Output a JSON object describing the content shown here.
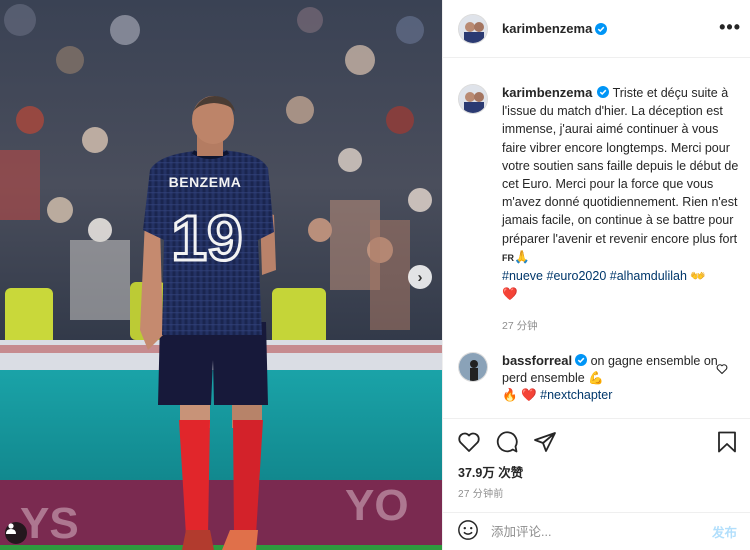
{
  "post": {
    "image_alt": "Karim Benzema in France jersey number 19 walking away on the pitch",
    "jersey_name": "BENZEMA",
    "jersey_number": "19"
  },
  "header": {
    "username": "karimbenzema",
    "verified": true,
    "more_icon": "more-options-icon"
  },
  "caption": {
    "username": "karimbenzema",
    "text": "Triste et déçu suite à l'issue du match d'hier. La déception est immense, j'aurai aimé continuer à vous faire vibrer encore longtemps. Merci pour votre soutien sans faille depuis le début de cet Euro. Merci pour la force que vous m'avez donné quotidiennement. Rien n'est jamais facile, on continue à se battre pour préparer l'avenir et revenir encore plus fort ",
    "flag": "FR",
    "pray_emoji": "🙏",
    "hashtags": [
      "#nueve",
      "#euro2020",
      "#alhamdulilah"
    ],
    "hands_emoji": "👐",
    "heart_emoji": "❤️",
    "time": "27 分钟"
  },
  "comment": {
    "username": "bassforreal",
    "verified": true,
    "text": "on gagne ensemble on perd ensemble",
    "muscle_emoji": "💪",
    "fire_emoji": "🔥",
    "heart_emoji": "❤️",
    "hashtag": "#nextchapter"
  },
  "actions": {
    "like_icon": "heart-icon",
    "comment_icon": "comment-bubble-icon",
    "share_icon": "paper-plane-icon",
    "save_icon": "bookmark-icon"
  },
  "stats": {
    "likes": "37.9万 次赞",
    "posted": "27 分钟前"
  },
  "compose": {
    "placeholder": "添加评论...",
    "post_label": "发布"
  },
  "colors": {
    "link": "#00376b",
    "verified": "#0095f6",
    "jersey": "#1e2a5a",
    "socks": "#e1262b",
    "post_button_disabled": "#b2dffc"
  }
}
